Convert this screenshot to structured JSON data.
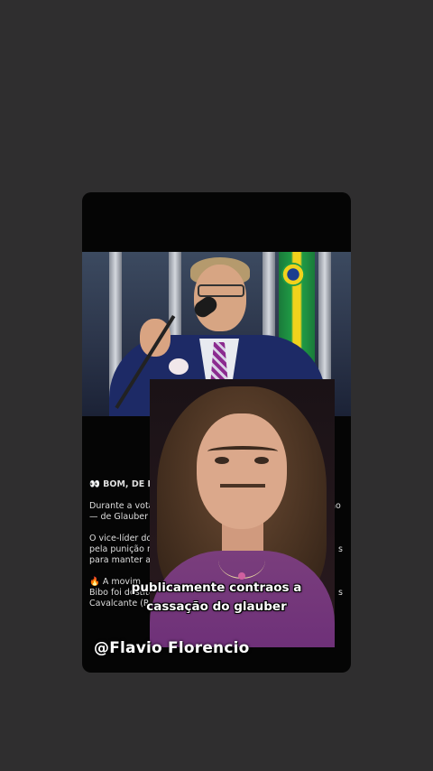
{
  "article": {
    "title": "👀 BOM, DE RACHA",
    "p1_line1": "Durante a votação",
    "p1_line1_end": "ção",
    "p1_line2": "— de Glauber Brac",
    "p2_line1": "O vice-líder do",
    "p2_line2": "pela punição m",
    "p2_line2_end": "s",
    "p2_line3": "para manter a c",
    "p3_line1": "🔥 A movim",
    "p3_line2": "Bibo foi destitu",
    "p3_line2_end": "s",
    "p3_line3": "Cavalcante (RJ"
  },
  "caption": {
    "line1": "publicamente contraos a",
    "line2": "cassação do glauber"
  },
  "watermark": {
    "handle": "@Flavio Florencio"
  },
  "colors": {
    "background": "#2f2e2f",
    "card": "#050505",
    "caption_text": "#ffffff"
  }
}
